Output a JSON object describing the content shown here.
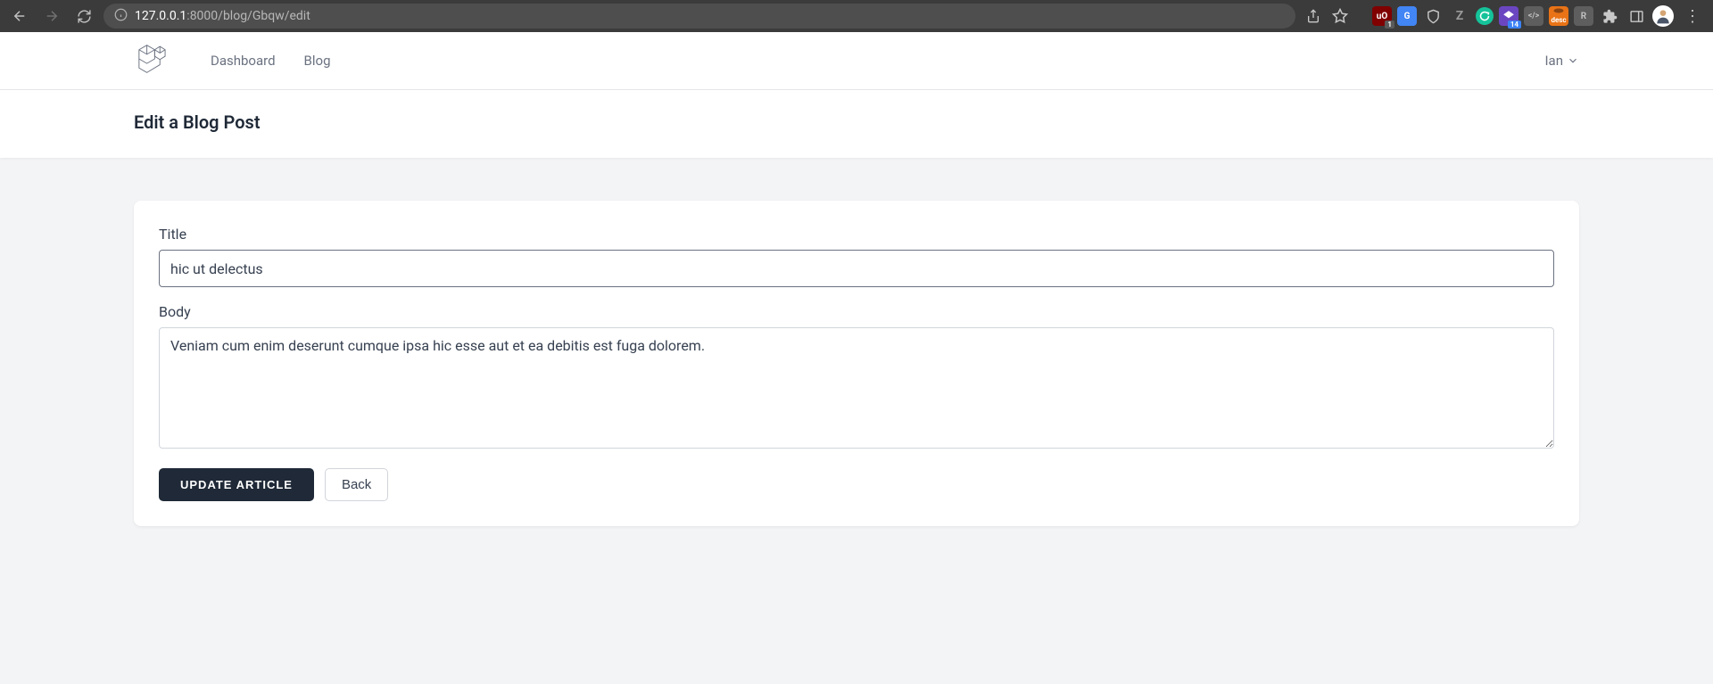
{
  "browser": {
    "url_host": "127.0.0.1",
    "url_port": ":8000",
    "url_path": "/blog/Gbqw/edit",
    "ublock_badge": "1",
    "purple_badge": "14",
    "desc_label": "desc"
  },
  "nav": {
    "links": {
      "dashboard": "Dashboard",
      "blog": "Blog"
    },
    "user": "Ian"
  },
  "page": {
    "title": "Edit a Blog Post"
  },
  "form": {
    "title_label": "Title",
    "title_value": "hic ut delectus",
    "body_label": "Body",
    "body_value": "Veniam cum enim deserunt cumque ipsa hic esse aut et ea debitis est fuga dolorem.",
    "submit_label": "Update Article",
    "back_label": "Back"
  }
}
